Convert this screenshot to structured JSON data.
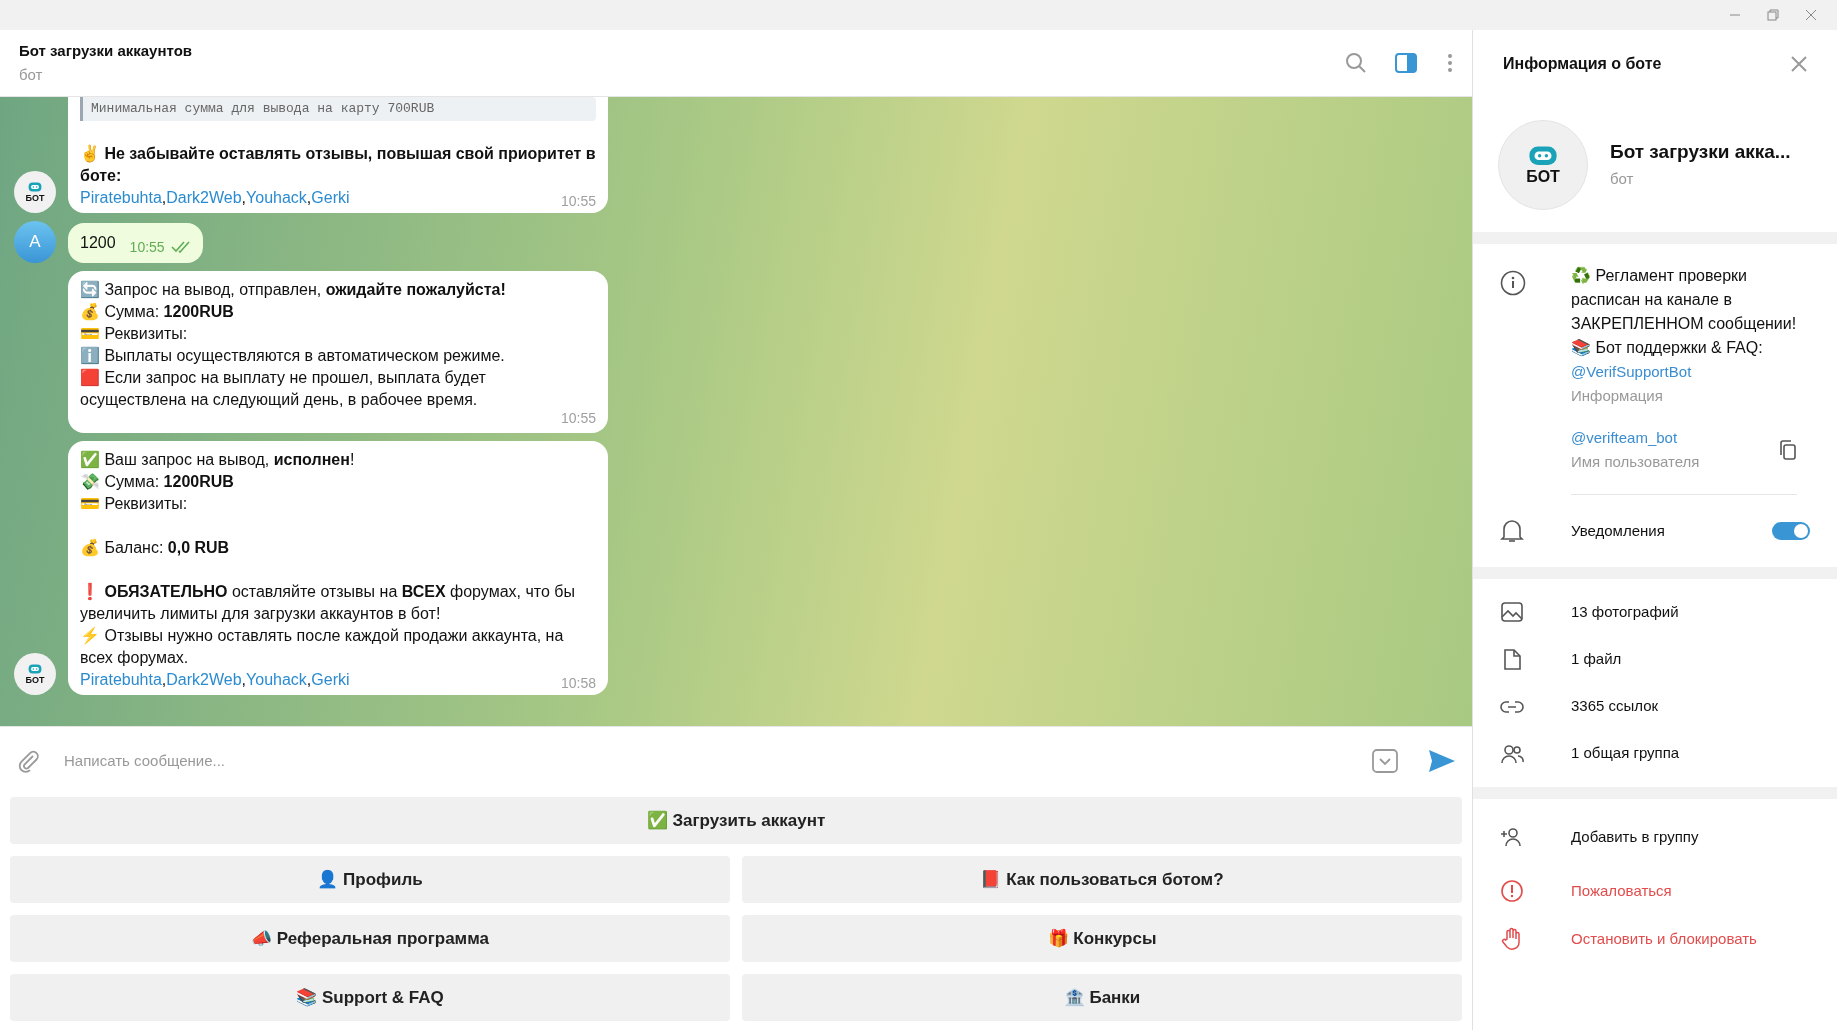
{
  "chat": {
    "title": "Бот загрузки аккаунтов",
    "subtitle": "бот"
  },
  "messages": [
    {
      "kind": "bot",
      "avatar": "БОТ",
      "quote": "Минимальная сумма для вывода на карту 700RUB",
      "paragraphs": [
        [
          "✌️ **Не забывайте оставлять отзывы, повышая свой приоритет в боте:**"
        ]
      ],
      "links": [
        "Piratebuhta",
        "Dark2Web",
        "Youhack",
        "Gerki"
      ],
      "link_separator": ", ",
      "time": "10:55"
    },
    {
      "kind": "user",
      "avatar": "A",
      "paragraphs": [
        [
          "1200"
        ]
      ],
      "time": "10:55",
      "read": true
    },
    {
      "kind": "bot",
      "paragraphs": [
        [
          "🔄 Запрос на вывод,  отправлен, **ожидайте пожалуйста!**",
          "💰 Сумма: **1200RUB**",
          "💳 Реквизиты:",
          "ℹ️ Выплаты осуществляются в автоматическом режиме.",
          "🟥 Если запрос на выплату не прошел, выплата будет осуществлена на следующий день, в рабочее время."
        ]
      ],
      "time": "10:55"
    },
    {
      "kind": "bot",
      "avatar": "БОТ",
      "paragraphs": [
        [
          "✅ Ваш запрос на вывод, **исполнен**!",
          "💸 Сумма: **1200RUB**",
          "💳 Реквизиты:"
        ],
        [
          "💰 Баланс: **0,0 RUB**"
        ],
        [
          "❗ **ОБЯЗАТЕЛЬНО** оставляйте отзывы на **ВСЕХ** форумах, что бы увеличить лимиты для загрузки аккаунтов в бот!",
          "⚡ Отзывы нужно оставлять после каждой продажи аккаунта, на всех форумах."
        ]
      ],
      "links": [
        "Piratebuhta",
        "Dark2Web",
        "Youhack",
        "Gerki"
      ],
      "link_separator": ", ",
      "time": "10:58"
    }
  ],
  "composer": {
    "placeholder": "Написать сообщение..."
  },
  "keyboard": [
    [
      "✅ Загрузить аккаунт"
    ],
    [
      "👤 Профиль",
      "📕 Как пользоваться ботом?"
    ],
    [
      "📣 Реферальная программа",
      "🎁 Конкурсы"
    ],
    [
      "📚 Support & FAQ",
      "🏦 Банки"
    ]
  ],
  "panel": {
    "title": "Информация о боте",
    "avatar": "БОТ",
    "name": "Бот загрузки акка...",
    "subtitle": "бот",
    "info": {
      "lines": [
        "♻️ Регламент проверки расписан на канале в ЗАКРЕПЛЕННОМ сообщении!",
        "📚 Бот поддержки & FAQ:"
      ],
      "link": "@VerifSupportBot",
      "caption": "Информация"
    },
    "username": {
      "value": "@verifteam_bot",
      "caption": "Имя пользователя"
    },
    "notifications": {
      "label": "Уведомления",
      "on": true
    },
    "media": [
      {
        "kind": "photo",
        "label": "13 фотографий"
      },
      {
        "kind": "file",
        "label": "1 файл"
      },
      {
        "kind": "link",
        "label": "3365 ссылок"
      },
      {
        "kind": "group",
        "label": "1 общая группа"
      }
    ],
    "actions": [
      {
        "kind": "add",
        "label": "Добавить в группу",
        "danger": false
      },
      {
        "kind": "report",
        "label": "Пожаловаться",
        "danger": true
      },
      {
        "kind": "block",
        "label": "Остановить и блокировать",
        "danger": true
      }
    ]
  }
}
